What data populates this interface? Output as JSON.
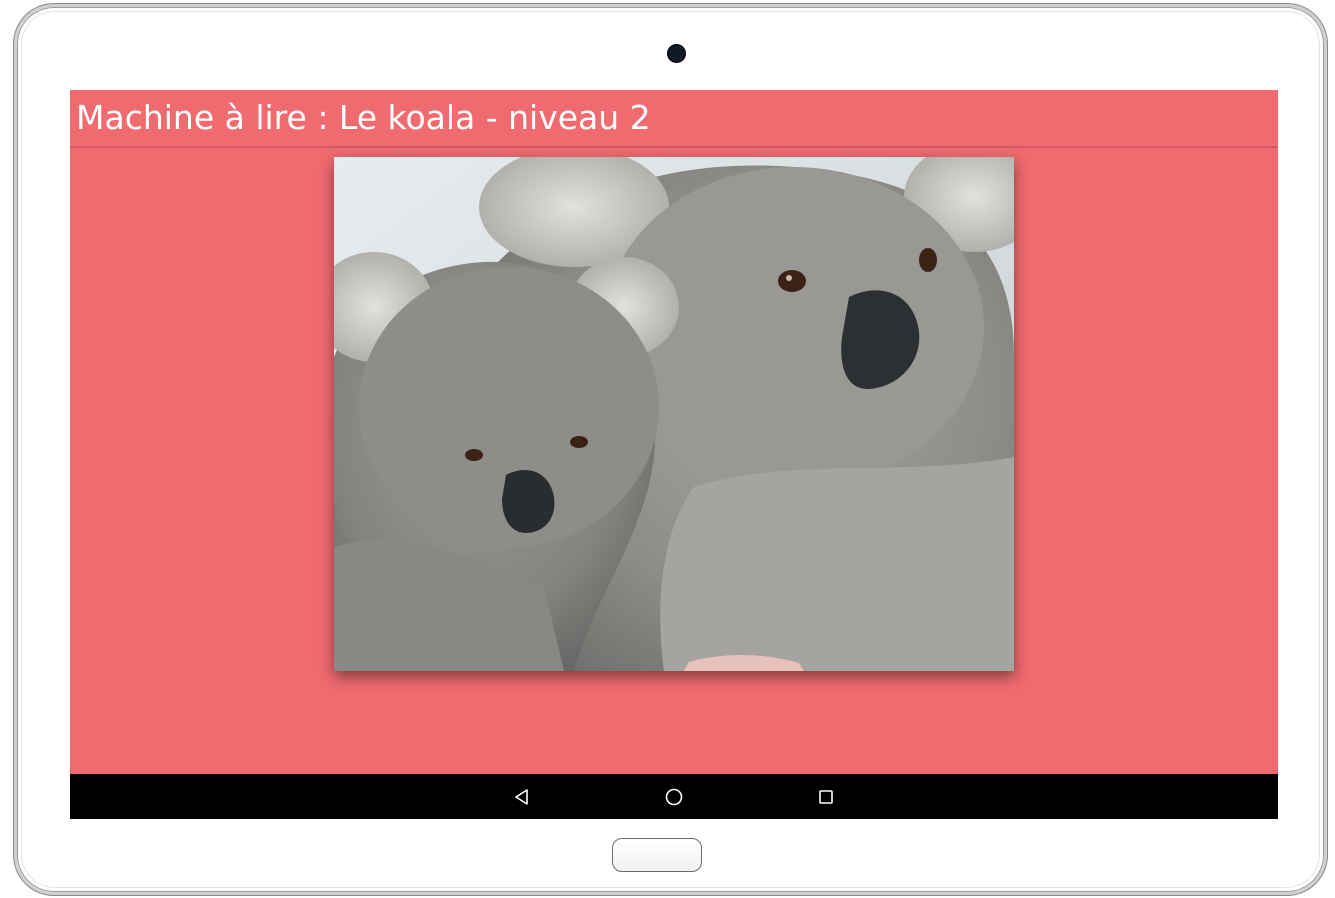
{
  "app": {
    "title": "Machine à lire : Le koala - niveau 2"
  },
  "content": {
    "image": {
      "subject": "two-koalas-photo"
    }
  },
  "navigation": {
    "back_icon": "back-triangle-icon",
    "home_icon": "home-circle-icon",
    "recents_icon": "recents-square-icon"
  },
  "colors": {
    "screen_background": "#ef6b6f",
    "nav_bar": "#000000",
    "title_text": "#ffffff"
  }
}
